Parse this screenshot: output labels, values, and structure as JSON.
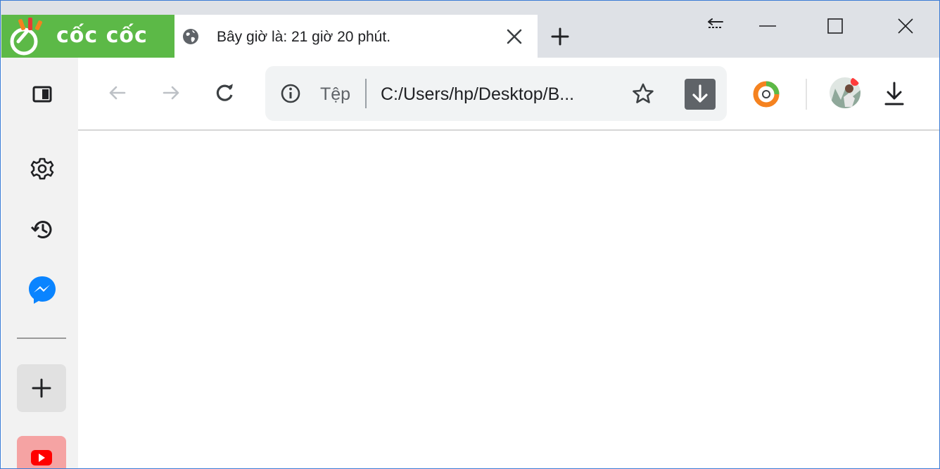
{
  "brand": {
    "name": "cốc cốc",
    "color": "#5cb947"
  },
  "tab": {
    "title": "Bây giờ là: 21 giờ 20 phút.",
    "favicon": "globe-icon"
  },
  "window_controls": [
    "tab-search-icon",
    "minimize-icon",
    "maximize-icon",
    "close-icon"
  ],
  "toolbar": {
    "back": "arrow-left-icon",
    "forward": "arrow-right-icon",
    "reload": "reload-icon"
  },
  "omnibox": {
    "scheme_label": "Tệp",
    "url": "C:/Users/hp/Desktop/B...",
    "info_icon": "info-icon",
    "bookmark_icon": "star-icon",
    "download_icon": "download-arrow-icon"
  },
  "extensions": [
    "coccoc-extension-icon"
  ],
  "profile": {
    "avatar_icon": "profile-avatar"
  },
  "downloads_icon": "download-icon",
  "sidebar": {
    "items": [
      {
        "icon": "side-panel-icon"
      },
      {
        "icon": "gear-icon"
      },
      {
        "icon": "history-icon"
      },
      {
        "icon": "messenger-icon"
      },
      {
        "icon": "plus-icon"
      },
      {
        "icon": "youtube-icon"
      }
    ]
  },
  "colors": {
    "tabstrip": "#dee1e6",
    "sidebar": "#f2f2f2",
    "messenger": "#0a84ff",
    "youtube": "#ff0000",
    "coccoc_orange": "#f5821f"
  }
}
